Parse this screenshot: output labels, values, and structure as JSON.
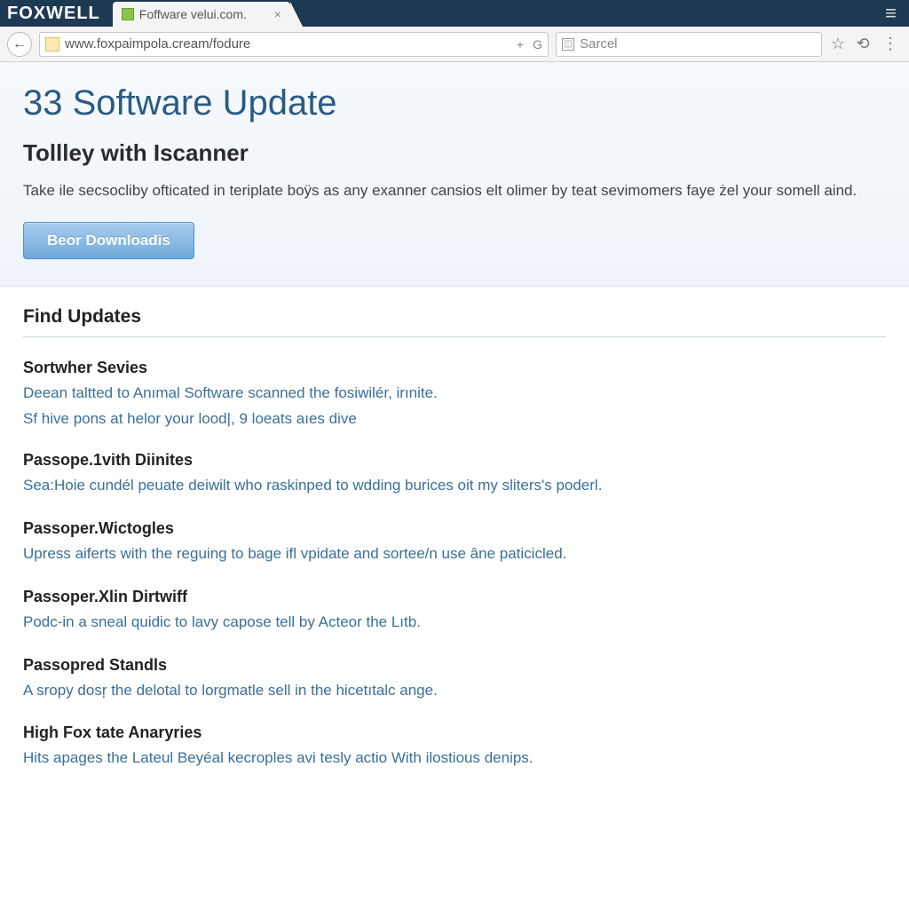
{
  "browser": {
    "brand": "FOXWELL",
    "tab_title": "Foffware velui.com.",
    "url": "www.foxpaimpola.cream/fodure",
    "omni_plus": "+",
    "omni_g": "G",
    "search_placeholder": "Sarcel",
    "icons": {
      "back": "←",
      "close": "×",
      "hamburger": "≡",
      "star": "☆",
      "refresh": "⟲",
      "kebab": "⋮"
    }
  },
  "hero": {
    "title": "33 Software Update",
    "subtitle": "Tollley with Iscanner",
    "blurb": "Take ile secsocliby ofticated in teriplate boÿs as any exanner cansios elt olimer by teat sevimomers faye żel your somell aind.",
    "button": "Beor Downloadis"
  },
  "section_title": "Find Updates",
  "items": [
    {
      "title": "Sortwher Sevies",
      "desc": "Deean taltted to Anımal Software scanned the fosiwilér, irınite.",
      "sub": "Sf hive pons at helor your lood|, 9 loeats aıes dive"
    },
    {
      "title": "Passope.1vith Diinites",
      "desc": "Sea:Hoie cundél peuate deiwilt who raskinped to wdding burices oit my sliters's poderl."
    },
    {
      "title": "Passoper.Wictogles",
      "desc": "Upress aiferts with the reguing to bage ifl vpidate and sortee/n use âne paticicled."
    },
    {
      "title": "Passoper.Xlin Dirtwiff",
      "desc": "Podc-in a sneal quidic to lavy capose tell by Acteor the Lıtb."
    },
    {
      "title": "Passopred Standls",
      "desc": "A sropy dosŗ the delotal to lorgmatle sell in the hicetıtalc ange."
    },
    {
      "title": "High Fox tate Anaryries",
      "desc": "Hits apages the Lateul Beyéal kecroples avi tesly actio With ilostious denips."
    }
  ]
}
